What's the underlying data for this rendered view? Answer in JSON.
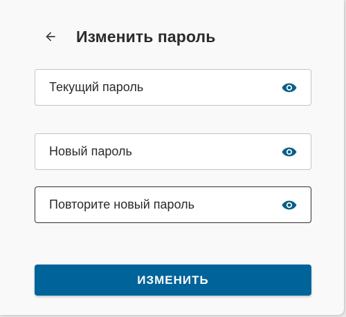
{
  "header": {
    "back_icon": "arrow-left-icon",
    "title": "Изменить пароль"
  },
  "form": {
    "fields": [
      {
        "label": "Текущий пароль",
        "value": "",
        "icon": "eye-icon"
      },
      {
        "label": "Новый пароль",
        "value": "",
        "icon": "eye-icon"
      },
      {
        "label": "Повторите новый пароль",
        "value": "",
        "icon": "eye-icon"
      }
    ],
    "submit_label": "ИЗМЕНИТЬ"
  },
  "colors": {
    "accent": "#00639a",
    "eye_icon": "#0a5f86",
    "text": "#2a2a2a",
    "card_bg": "#f9f9f9"
  }
}
